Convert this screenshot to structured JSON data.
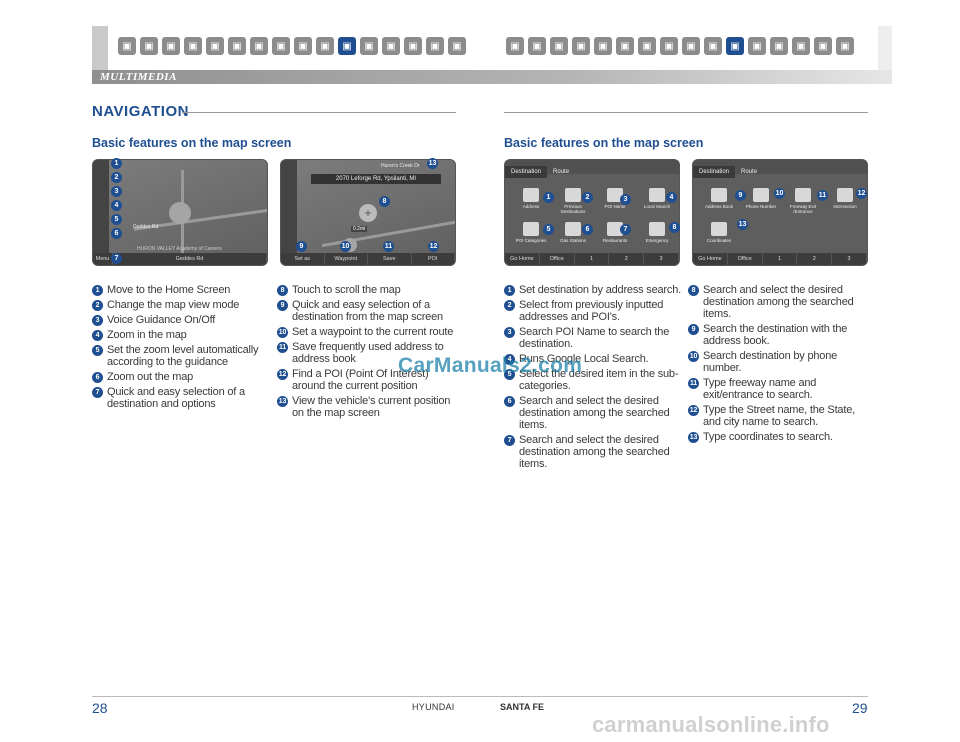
{
  "header": {
    "section_label": "MULTIMEDIA",
    "icons_left": [
      "car-icon",
      "steering-icon",
      "seat-icon",
      "key-icon",
      "wheel-icon",
      "engine-icon",
      "dashboard-icon",
      "wrench-icon",
      "bluetooth-icon",
      "gauge-icon",
      "multimedia-icon",
      "book-icon",
      "tool-icon",
      "lamp-icon",
      "ac-icon",
      "window-icon"
    ],
    "icons_right": [
      "car-icon",
      "steering-icon",
      "seat-icon",
      "key-icon",
      "camera-icon",
      "engine-icon",
      "dashboard-icon",
      "wrench-icon",
      "bluetooth-icon",
      "gauge-icon",
      "multimedia-icon",
      "book-icon",
      "tool-icon",
      "lamp-icon",
      "ac-icon",
      "window-icon"
    ],
    "active_icon_index": 10,
    "accent_color": "#1f4f91"
  },
  "left_page": {
    "title": "NAVIGATION",
    "subtitle": "Basic features on the map screen",
    "screen1": {
      "road_label_1": "Geddes Rd",
      "road_label_2": "HURON VALLEY Academy of Careers",
      "menu_label": "Menu",
      "bottom_road": "Geddes Rd"
    },
    "screen2": {
      "address": "2070 Leforge Rd, Ypsilanti, MI",
      "road_label": "Huron's Creek Dr",
      "distance": "0.2mi",
      "buttons": [
        "Set as Destination",
        "Waypoint",
        "Save",
        "POI"
      ]
    },
    "list_a": [
      {
        "n": "1",
        "text": "Move to the Home Screen"
      },
      {
        "n": "2",
        "text": "Change the map view mode"
      },
      {
        "n": "3",
        "text": "Voice Guidance On/Off"
      },
      {
        "n": "4",
        "text": "Zoom in the map"
      },
      {
        "n": "5",
        "text": "Set the zoom level automatically according to the guidance"
      },
      {
        "n": "6",
        "text": "Zoom out the map"
      },
      {
        "n": "7",
        "text": "Quick and easy selection of a destination and options"
      }
    ],
    "list_b": [
      {
        "n": "8",
        "text": "Touch to scroll the map"
      },
      {
        "n": "9",
        "text": "Quick and easy selection of a destination from the map screen"
      },
      {
        "n": "10",
        "text": "Set a waypoint to the current route"
      },
      {
        "n": "11",
        "text": "Save frequently used address to address book"
      },
      {
        "n": "12",
        "text": "Find a POI (Point Of Interest) around the current position"
      },
      {
        "n": "13",
        "text": "View the vehicle's current position on the map screen"
      }
    ],
    "page_number": "28",
    "brand": "HYUNDAI"
  },
  "right_page": {
    "subtitle": "Basic features on the map screen",
    "screen3": {
      "tabs": [
        "Destination",
        "Route"
      ],
      "tiles": [
        "Address",
        "Previous Destinations",
        "POI Name",
        "Local Search",
        "POI Categories",
        "Gas Stations",
        "Restaurants",
        "Emergency"
      ],
      "bottom": [
        "Go Home",
        "Office",
        "1",
        "2",
        "3"
      ]
    },
    "screen4": {
      "tabs": [
        "Destination",
        "Route"
      ],
      "tiles": [
        "Address Book",
        "Phone Number",
        "Freeway Exit /Entrance",
        "Intersection",
        "Coordinates"
      ],
      "bottom": [
        "Go Home",
        "Office",
        "1",
        "2",
        "3"
      ]
    },
    "list_c": [
      {
        "n": "1",
        "text": "Set destination by address search."
      },
      {
        "n": "2",
        "text": "Select from previously inputted addresses and POI's."
      },
      {
        "n": "3",
        "text": "Search POI Name to search the destination."
      },
      {
        "n": "4",
        "text": "Runs Google Local Search."
      },
      {
        "n": "5",
        "text": "Select the desired item in the sub-categories."
      },
      {
        "n": "6",
        "text": "Search and select the desired destination among the searched items."
      },
      {
        "n": "7",
        "text": "Search and select the desired destination among the searched items."
      }
    ],
    "list_d": [
      {
        "n": "8",
        "text": "Search and select the desired destination among the searched items."
      },
      {
        "n": "9",
        "text": "Search the destination with the address book."
      },
      {
        "n": "10",
        "text": "Search destination by phone number."
      },
      {
        "n": "11",
        "text": "Type freeway name and exit/entrance to search."
      },
      {
        "n": "12",
        "text": "Type the Street name, the State, and city name to search."
      },
      {
        "n": "13",
        "text": "Type coordinates to search."
      }
    ],
    "page_number": "29",
    "model": "SANTA FE"
  },
  "watermark": "CarManuals2.com",
  "site_watermark": "carmanualsonline.info"
}
